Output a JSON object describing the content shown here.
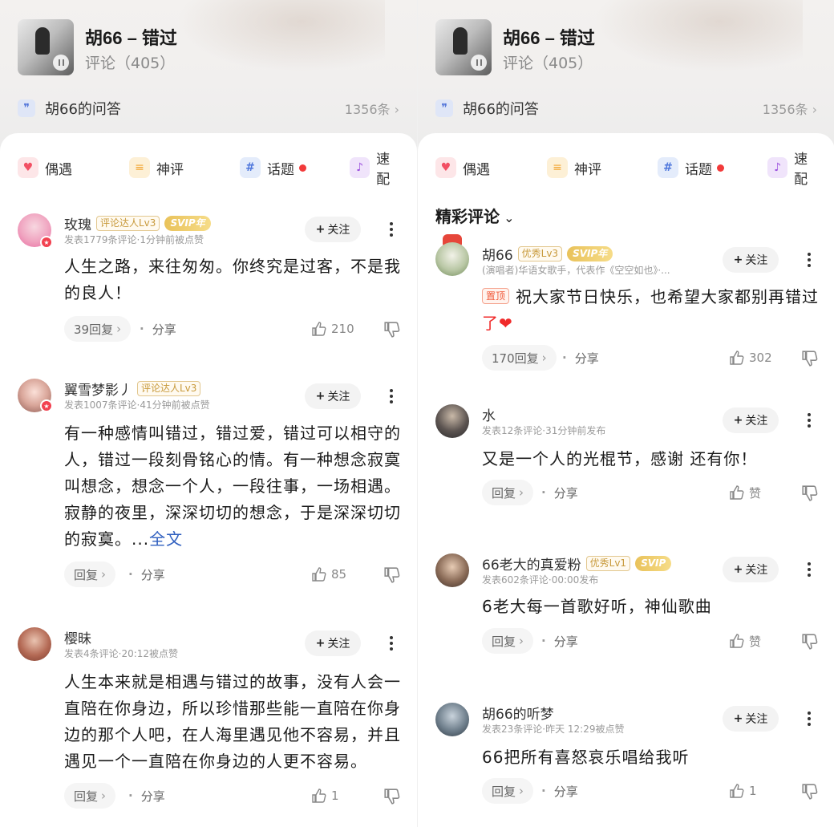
{
  "colors": {
    "accent_link": "#2f5fbf",
    "badge_red": "#f23a3a",
    "svip_gold": "#e9c25a"
  },
  "panels": [
    {
      "header": {
        "title": "胡66 – 错过",
        "subtitle": "评论（405）"
      },
      "qa": {
        "label": "胡66的问答",
        "count": "1356条"
      },
      "chips": [
        {
          "label": "偶遇",
          "icon": "heart-icon"
        },
        {
          "label": "神评",
          "icon": "quote-icon"
        },
        {
          "label": "话题",
          "icon": "hash-icon"
        },
        {
          "label": "速配",
          "icon": "music-note-icon"
        }
      ],
      "section_title": "",
      "comments": [
        {
          "user": "玫瑰",
          "level": "评论达人Lv3",
          "svip": "SVIP年",
          "meta": "发表1779条评论·1分钟前被点赞",
          "follow": "关注",
          "lines": [
            "人生之路，来往匆匆。你终究是过客，不是我",
            "的良人！"
          ],
          "more": "",
          "pin": "",
          "reply": "39回复",
          "share": "分享",
          "likes": "210"
        },
        {
          "user": "翼雪梦影丿",
          "level": "评论达人Lv3",
          "svip": "",
          "meta": "发表1007条评论·41分钟前被点赞",
          "follow": "关注",
          "lines": [
            "有一种感情叫错过，错过爱，错过可以相守的",
            "人，错过一段刻骨铭心的情。有一种想念寂寞",
            "叫想念，想念一个人，一段往事，一场相遇。",
            "寂静的夜里，深深切切的想念，于是深深切切",
            "的寂寞。..."
          ],
          "more": "全文",
          "pin": "",
          "reply": "回复",
          "share": "分享",
          "likes": "85"
        },
        {
          "user": "樱昧",
          "level": "",
          "svip": "",
          "meta": "发表4条评论·20:12被点赞",
          "follow": "关注",
          "lines": [
            "人生本来就是相遇与错过的故事，没有人会一",
            "直陪在你身边，所以珍惜那些能一直陪在你身",
            "边的那个人吧，在人海里遇见他不容易，并且",
            "遇见一个一直陪在你身边的人更不容易。"
          ],
          "more": "",
          "pin": "",
          "reply": "回复",
          "share": "分享",
          "likes": "1"
        }
      ]
    },
    {
      "header": {
        "title": "胡66 – 错过",
        "subtitle": "评论（405）"
      },
      "qa": {
        "label": "胡66的问答",
        "count": "1356条"
      },
      "chips": [
        {
          "label": "偶遇",
          "icon": "heart-icon"
        },
        {
          "label": "神评",
          "icon": "quote-icon"
        },
        {
          "label": "话题",
          "icon": "hash-icon"
        },
        {
          "label": "速配",
          "icon": "music-note-icon"
        }
      ],
      "section_title": "精彩评论",
      "comments": [
        {
          "user": "胡66",
          "level": "优秀Lv3",
          "svip": "SVIP年",
          "meta": "(演唱者)华语女歌手，代表作《空空如也》·...",
          "follow": "关注",
          "lines": [
            "祝大家节日快乐，也希望大家都别再错过",
            "了❤"
          ],
          "more": "",
          "pin": "置顶",
          "reply": "170回复",
          "share": "分享",
          "likes": "302"
        },
        {
          "user": "水",
          "level": "",
          "svip": "",
          "meta": "发表12条评论·31分钟前发布",
          "follow": "关注",
          "lines": [
            "又是一个人的光棍节，感谢  还有你！"
          ],
          "more": "",
          "pin": "",
          "reply": "回复",
          "share": "分享",
          "likes": "赞"
        },
        {
          "user": "66老大的真爱粉",
          "level": "优秀Lv1",
          "svip": "SVIP",
          "meta": "发表602条评论·00:00发布",
          "follow": "关注",
          "lines": [
            "6老大每一首歌好听，神仙歌曲"
          ],
          "more": "",
          "pin": "",
          "reply": "回复",
          "share": "分享",
          "likes": "赞"
        },
        {
          "user": "胡66的听梦",
          "level": "",
          "svip": "",
          "meta": "发表23条评论·昨天 12:29被点赞",
          "follow": "关注",
          "lines": [
            "66把所有喜怒哀乐唱给我听"
          ],
          "more": "",
          "pin": "",
          "reply": "回复",
          "share": "分享",
          "likes": "1"
        }
      ]
    }
  ]
}
